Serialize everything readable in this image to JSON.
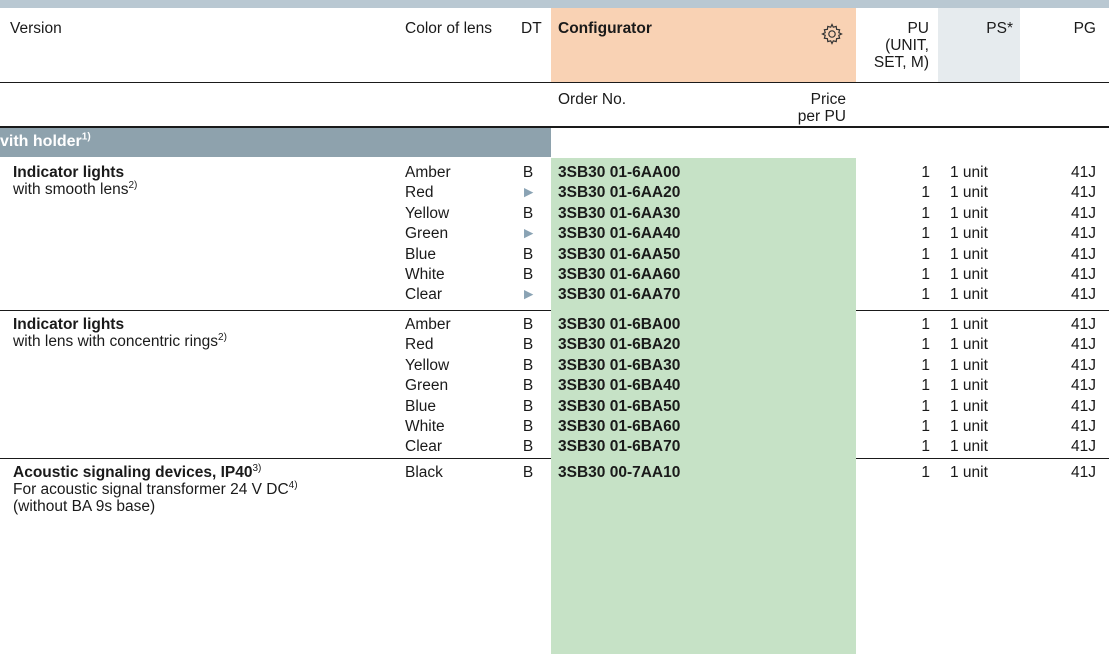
{
  "header": {
    "version": "Version",
    "color_of_lens": "Color of lens",
    "dt": "DT",
    "configurator": "Configurator",
    "pu_line1": "PU",
    "pu_line2": "(UNIT,",
    "pu_line3": "SET, M)",
    "ps": "PS*",
    "pg": "PG",
    "order_no": "Order No.",
    "price_line1": "Price",
    "price_line2": "per PU"
  },
  "icons": {
    "configurator": "gear-icon",
    "dt_preferred": "triangle-right-icon"
  },
  "section": {
    "title": "vith holder",
    "footnote": "1)"
  },
  "groups": [
    {
      "title": "Indicator lights",
      "sub": "with smooth lens",
      "sub_note": "2)",
      "rows": [
        {
          "color": "Amber",
          "dt": "B",
          "order": "3SB30 01-6AA00",
          "pu": "1",
          "ps": "1 unit",
          "pg": "41J"
        },
        {
          "color": "Red",
          "dt": "►",
          "order": "3SB30 01-6AA20",
          "pu": "1",
          "ps": "1 unit",
          "pg": "41J"
        },
        {
          "color": "Yellow",
          "dt": "B",
          "order": "3SB30 01-6AA30",
          "pu": "1",
          "ps": "1 unit",
          "pg": "41J"
        },
        {
          "color": "Green",
          "dt": "►",
          "order": "3SB30 01-6AA40",
          "pu": "1",
          "ps": "1 unit",
          "pg": "41J"
        },
        {
          "color": "Blue",
          "dt": "B",
          "order": "3SB30 01-6AA50",
          "pu": "1",
          "ps": "1 unit",
          "pg": "41J"
        },
        {
          "color": "White",
          "dt": "B",
          "order": "3SB30 01-6AA60",
          "pu": "1",
          "ps": "1 unit",
          "pg": "41J"
        },
        {
          "color": "Clear",
          "dt": "►",
          "order": "3SB30 01-6AA70",
          "pu": "1",
          "ps": "1 unit",
          "pg": "41J"
        }
      ]
    },
    {
      "title": "Indicator lights",
      "sub": "with lens with concentric rings",
      "sub_note": "2)",
      "rows": [
        {
          "color": "Amber",
          "dt": "B",
          "order": "3SB30 01-6BA00",
          "pu": "1",
          "ps": "1 unit",
          "pg": "41J"
        },
        {
          "color": "Red",
          "dt": "B",
          "order": "3SB30 01-6BA20",
          "pu": "1",
          "ps": "1 unit",
          "pg": "41J"
        },
        {
          "color": "Yellow",
          "dt": "B",
          "order": "3SB30 01-6BA30",
          "pu": "1",
          "ps": "1 unit",
          "pg": "41J"
        },
        {
          "color": "Green",
          "dt": "B",
          "order": "3SB30 01-6BA40",
          "pu": "1",
          "ps": "1 unit",
          "pg": "41J"
        },
        {
          "color": "Blue",
          "dt": "B",
          "order": "3SB30 01-6BA50",
          "pu": "1",
          "ps": "1 unit",
          "pg": "41J"
        },
        {
          "color": "White",
          "dt": "B",
          "order": "3SB30 01-6BA60",
          "pu": "1",
          "ps": "1 unit",
          "pg": "41J"
        },
        {
          "color": "Clear",
          "dt": "B",
          "order": "3SB30 01-6BA70",
          "pu": "1",
          "ps": "1 unit",
          "pg": "41J"
        }
      ]
    },
    {
      "title": "Acoustic signaling devices, IP40",
      "title_note": "3)",
      "sub": "For acoustic signal transformer 24 V DC",
      "sub_note": "4)",
      "sub2": "(without BA 9s base)",
      "rows": [
        {
          "color": "Black",
          "dt": "B",
          "order": "3SB30 00-7AA10",
          "pu": "1",
          "ps": "1 unit",
          "pg": "41J"
        }
      ]
    }
  ],
  "colors": {
    "configurator_bg": "#f9d2b4",
    "order_col_bg": "#c6e2c6",
    "section_bar": "#8ea2ad",
    "ps_header_bg": "#e6ebee",
    "preferred_arrow": "#8aa3b4"
  }
}
